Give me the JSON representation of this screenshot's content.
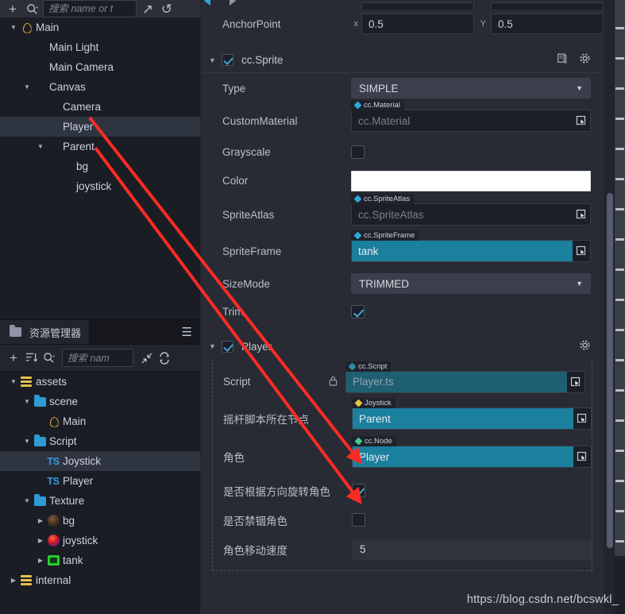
{
  "hierarchy_panel": {
    "toolbar": {
      "add_icon": "plus-icon",
      "search_icon": "search-icon",
      "search_placeholder": "搜索 name or t",
      "expand_icon": "expand-icon",
      "refresh_icon": "refresh-icon"
    },
    "nodes": [
      {
        "label": "Main",
        "depth": 0,
        "twisty": "open",
        "icon": "scene-drop-icon",
        "selected": false
      },
      {
        "label": "Main Light",
        "depth": 1,
        "twisty": "none",
        "icon": "none",
        "selected": false
      },
      {
        "label": "Main Camera",
        "depth": 1,
        "twisty": "none",
        "icon": "none",
        "selected": false
      },
      {
        "label": "Canvas",
        "depth": 1,
        "twisty": "open",
        "icon": "none",
        "selected": false
      },
      {
        "label": "Camera",
        "depth": 2,
        "twisty": "none",
        "icon": "none",
        "selected": false
      },
      {
        "label": "Player",
        "depth": 2,
        "twisty": "none",
        "icon": "none",
        "selected": true
      },
      {
        "label": "Parent",
        "depth": 2,
        "twisty": "open",
        "icon": "none",
        "selected": false
      },
      {
        "label": "bg",
        "depth": 3,
        "twisty": "none",
        "icon": "none",
        "selected": false
      },
      {
        "label": "joystick",
        "depth": 3,
        "twisty": "none",
        "icon": "none",
        "selected": false
      }
    ]
  },
  "assets_panel": {
    "tab_label": "资源管理器",
    "tab_icon": "folder-icon",
    "menu_icon": "hamburger-icon",
    "toolbar": {
      "add_icon": "plus-icon",
      "sort_icon": "sort-icon",
      "search_icon": "search-icon",
      "search_placeholder": "搜索 nam",
      "collapse_icon": "collapse-icon",
      "refresh_icon": "refresh-icon"
    },
    "nodes": [
      {
        "label": "assets",
        "depth": 0,
        "twisty": "open",
        "icon": "assets-db-icon",
        "selected": false
      },
      {
        "label": "scene",
        "depth": 1,
        "twisty": "open",
        "icon": "folder-icon",
        "selected": false
      },
      {
        "label": "Main",
        "depth": 2,
        "twisty": "none",
        "icon": "scene-drop-icon",
        "selected": false
      },
      {
        "label": "Script",
        "depth": 1,
        "twisty": "open",
        "icon": "folder-icon",
        "selected": false
      },
      {
        "label": "Joystick",
        "depth": 2,
        "twisty": "none",
        "icon": "typescript-icon",
        "selected": true
      },
      {
        "label": "Player",
        "depth": 2,
        "twisty": "none",
        "icon": "typescript-icon",
        "selected": false
      },
      {
        "label": "Texture",
        "depth": 1,
        "twisty": "open",
        "icon": "folder-icon",
        "selected": false
      },
      {
        "label": "bg",
        "depth": 2,
        "twisty": "closed",
        "icon": "texture-bg-icon",
        "selected": false
      },
      {
        "label": "joystick",
        "depth": 2,
        "twisty": "closed",
        "icon": "texture-joystick-icon",
        "selected": false
      },
      {
        "label": "tank",
        "depth": 2,
        "twisty": "closed",
        "icon": "texture-tank-icon",
        "selected": false
      },
      {
        "label": "internal",
        "depth": 0,
        "twisty": "closed",
        "icon": "assets-db-icon",
        "selected": false
      }
    ]
  },
  "inspector": {
    "nav_back_icon": "nav-back-icon",
    "nav_forward_icon": "nav-forward-icon",
    "anchor_point": {
      "label": "AnchorPoint",
      "x_axis": "x",
      "x_value": "0.5",
      "y_axis": "Y",
      "y_value": "0.5"
    },
    "sprite_component": {
      "title": "cc.Sprite",
      "enabled": true,
      "help_icon": "book-icon",
      "gear_icon": "gear-icon",
      "type": {
        "label": "Type",
        "value": "SIMPLE"
      },
      "custom_material": {
        "label": "CustomMaterial",
        "tag": "cc.Material",
        "tag_color": "#2ca8d8",
        "value": "cc.Material",
        "empty": true
      },
      "grayscale": {
        "label": "Grayscale",
        "checked": false
      },
      "color": {
        "label": "Color",
        "value": "#FFFFFF"
      },
      "sprite_atlas": {
        "label": "SpriteAtlas",
        "tag": "cc.SpriteAtlas",
        "tag_color": "#2ca8d8",
        "value": "cc.SpriteAtlas",
        "empty": true
      },
      "sprite_frame": {
        "label": "SpriteFrame",
        "tag": "cc.SpriteFrame",
        "tag_color": "#2ca8d8",
        "value": "tank",
        "empty": false
      },
      "size_mode": {
        "label": "SizeMode",
        "value": "TRIMMED"
      },
      "trim": {
        "label": "Trim",
        "checked": true
      }
    },
    "player_component": {
      "title": "Player",
      "enabled": true,
      "gear_icon": "gear-icon",
      "script": {
        "label": "Script",
        "lock_icon": "lock-icon",
        "tag": "cc.Script",
        "tag_color": "#2c8fa8",
        "value": "Player.ts"
      },
      "joystick_node": {
        "label": "摇杆脚本所在节点",
        "tag": "Joystick",
        "tag_color": "#e0c83c",
        "value": "Parent"
      },
      "role_node": {
        "label": "角色",
        "tag": "cc.Node",
        "tag_color": "#3fcf8e",
        "value": "Player"
      },
      "rotate_by_direction": {
        "label": "是否根据方向旋转角色",
        "checked": true
      },
      "confine_role": {
        "label": "是否禁锢角色",
        "checked": false
      },
      "move_speed": {
        "label": "角色移动速度",
        "value": "5"
      }
    }
  },
  "annotations": {
    "arrow_color": "#f82c25",
    "arrows": [
      {
        "name": "arrow-player-to-joystick-node",
        "from": [
          113,
          148
        ],
        "to": [
          449,
          576
        ]
      },
      {
        "name": "arrow-parent-to-role-node",
        "from": [
          120,
          186
        ],
        "to": [
          449,
          626
        ]
      }
    ]
  },
  "watermark": {
    "text": "https://blog.csdn.net/bcswkl_"
  }
}
